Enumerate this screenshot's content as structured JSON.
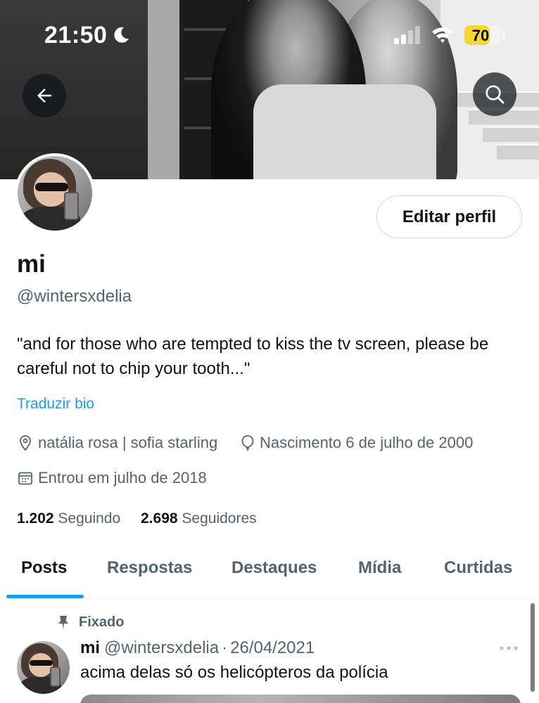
{
  "status_bar": {
    "time": "21:50",
    "battery": "70",
    "battery_level": 0.7
  },
  "profile": {
    "name": "mi",
    "handle": "@wintersxdelia",
    "bio": "\"and for those who are tempted to kiss the tv screen, please be careful not to chip your tooth...\"",
    "translate_label": "Traduzir bio",
    "edit_label": "Editar perfil",
    "location": "natália rosa | sofia starling",
    "birthday": "Nascimento 6 de julho de 2000",
    "joined": "Entrou em julho de 2018",
    "following_count": "1.202",
    "following_label": "Seguindo",
    "followers_count": "2.698",
    "followers_label": "Seguidores"
  },
  "tabs": [
    {
      "label": "Posts",
      "active": true
    },
    {
      "label": "Respostas",
      "active": false
    },
    {
      "label": "Destaques",
      "active": false
    },
    {
      "label": "Mídia",
      "active": false
    },
    {
      "label": "Curtidas",
      "active": false
    }
  ],
  "pinned_tweet": {
    "pinned_label": "Fixado",
    "author": "mi",
    "handle": "@wintersxdelia",
    "separator": "·",
    "date": "26/04/2021",
    "text": "acima delas só os helicópteros da polícia"
  },
  "colors": {
    "accent": "#1d9bf0",
    "text_primary": "#0f1419",
    "text_secondary": "#536471",
    "battery": "#f7d634"
  },
  "icons": [
    "moon-icon",
    "cellular-signal-icon",
    "wifi-icon",
    "back-arrow-icon",
    "search-icon",
    "location-pin-icon",
    "balloon-icon",
    "calendar-icon",
    "pin-icon",
    "more-options-icon"
  ]
}
